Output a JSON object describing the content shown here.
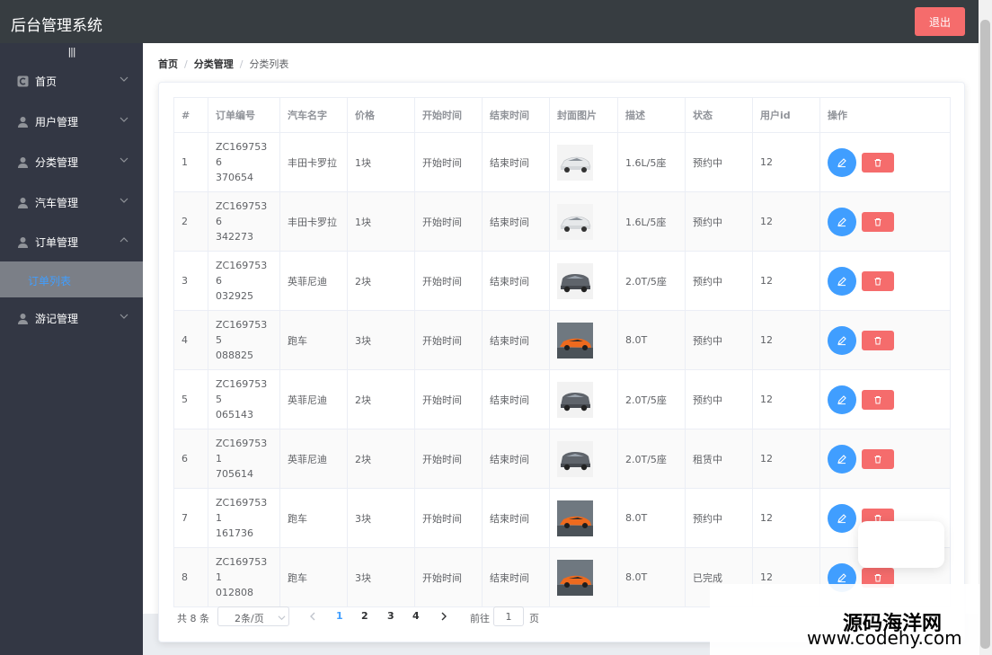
{
  "header": {
    "title": "后台管理系统",
    "logout_label": "退出"
  },
  "sidebar": {
    "toggle_label": "|||",
    "items": [
      {
        "label": "首页",
        "icon": "home-icon",
        "expanded": false
      },
      {
        "label": "用户管理",
        "icon": "user-icon",
        "expanded": false
      },
      {
        "label": "分类管理",
        "icon": "user-icon",
        "expanded": false
      },
      {
        "label": "汽车管理",
        "icon": "user-icon",
        "expanded": false
      },
      {
        "label": "订单管理",
        "icon": "user-icon",
        "expanded": true
      },
      {
        "label": "游记管理",
        "icon": "user-icon",
        "expanded": false
      }
    ],
    "submenu": {
      "label": "订单列表",
      "active": true
    }
  },
  "breadcrumb": {
    "home": "首页",
    "category": "分类管理",
    "current": "分类列表",
    "separator": "/"
  },
  "table": {
    "headers": [
      "#",
      "订单编号",
      "汽车名字",
      "价格",
      "开始时间",
      "结束时间",
      "封面图片",
      "描述",
      "状态",
      "用户id",
      "操作"
    ],
    "rows": [
      {
        "index": "1",
        "order_no_a": "ZC1697536",
        "order_no_b": "370654",
        "car": "丰田卡罗拉",
        "price": "1块",
        "start": "开始时间",
        "end": "结束时间",
        "image": "white-sedan",
        "desc": "1.6L/5座",
        "status": "预约中",
        "user_id": "12"
      },
      {
        "index": "2",
        "order_no_a": "ZC1697536",
        "order_no_b": "342273",
        "car": "丰田卡罗拉",
        "price": "1块",
        "start": "开始时间",
        "end": "结束时间",
        "image": "white-sedan",
        "desc": "1.6L/5座",
        "status": "预约中",
        "user_id": "12"
      },
      {
        "index": "3",
        "order_no_a": "ZC1697536",
        "order_no_b": "032925",
        "car": "英菲尼迪",
        "price": "2块",
        "start": "开始时间",
        "end": "结束时间",
        "image": "grey-suv",
        "desc": "2.0T/5座",
        "status": "预约中",
        "user_id": "12"
      },
      {
        "index": "4",
        "order_no_a": "ZC1697535",
        "order_no_b": "088825",
        "car": "跑车",
        "price": "3块",
        "start": "开始时间",
        "end": "结束时间",
        "image": "orange-sports",
        "desc": "8.0T",
        "status": "预约中",
        "user_id": "12"
      },
      {
        "index": "5",
        "order_no_a": "ZC1697535",
        "order_no_b": "065143",
        "car": "英菲尼迪",
        "price": "2块",
        "start": "开始时间",
        "end": "结束时间",
        "image": "grey-suv",
        "desc": "2.0T/5座",
        "status": "预约中",
        "user_id": "12"
      },
      {
        "index": "6",
        "order_no_a": "ZC1697531",
        "order_no_b": "705614",
        "car": "英菲尼迪",
        "price": "2块",
        "start": "开始时间",
        "end": "结束时间",
        "image": "grey-suv",
        "desc": "2.0T/5座",
        "status": "租赁中",
        "user_id": "12"
      },
      {
        "index": "7",
        "order_no_a": "ZC1697531",
        "order_no_b": "161736",
        "car": "跑车",
        "price": "3块",
        "start": "开始时间",
        "end": "结束时间",
        "image": "orange-sports",
        "desc": "8.0T",
        "status": "预约中",
        "user_id": "12"
      },
      {
        "index": "8",
        "order_no_a": "ZC1697531",
        "order_no_b": "012808",
        "car": "跑车",
        "price": "3块",
        "start": "开始时间",
        "end": "结束时间",
        "image": "orange-sports",
        "desc": "8.0T",
        "status": "已完成",
        "user_id": "12"
      }
    ]
  },
  "pagination": {
    "total": "共 8 条",
    "page_size": "2条/页",
    "pages": [
      "1",
      "2",
      "3",
      "4"
    ],
    "current_page": "1",
    "goto_label": "前往",
    "goto_value": "1",
    "page_suffix": "页"
  },
  "watermark": {
    "line1": "源码海洋网",
    "line2": "www.codehy.com"
  },
  "colors": {
    "primary": "#409eff",
    "danger": "#f56c6c",
    "sidebar_bg": "#333744",
    "header_bg": "#373d41"
  }
}
